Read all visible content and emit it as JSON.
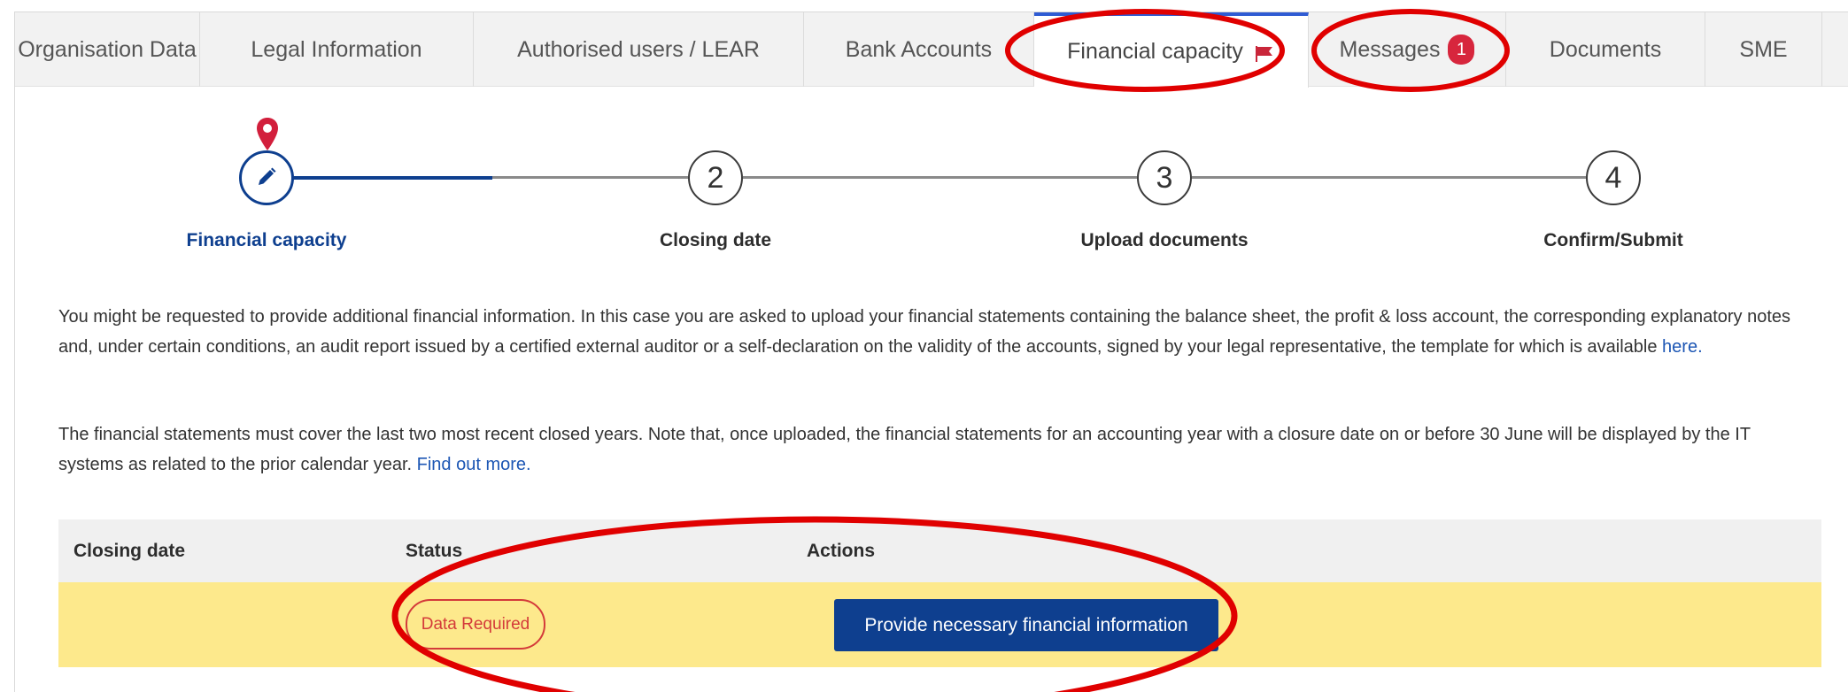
{
  "tabs": [
    {
      "label": "Organisation Data"
    },
    {
      "label": "Legal Information"
    },
    {
      "label": "Authorised users / LEAR"
    },
    {
      "label": "Bank Accounts"
    },
    {
      "label": "Financial capacity",
      "active": true
    },
    {
      "label": "Messages",
      "badge": "1"
    },
    {
      "label": "Documents"
    },
    {
      "label": "SME"
    }
  ],
  "stepper": {
    "steps": [
      {
        "number": "",
        "label": "Financial capacity",
        "state": "current"
      },
      {
        "number": "2",
        "label": "Closing date"
      },
      {
        "number": "3",
        "label": "Upload documents"
      },
      {
        "number": "4",
        "label": "Confirm/Submit"
      }
    ]
  },
  "info": {
    "p1_text": "You might be requested to provide additional financial information. In this case you are asked to upload your financial statements containing the balance sheet, the profit & loss account, the corresponding explanatory notes and, under certain conditions, an audit report issued by a certified external auditor or a self-declaration on the validity of the accounts, signed by your legal representative, the template for which is available ",
    "p1_link": "here.",
    "p2_text": "The financial statements must cover the last two most recent closed years. Note that, once uploaded, the financial statements for an accounting year with a closure date on or before 30 June will be displayed by the IT systems as related to the prior calendar year. ",
    "p2_link": "Find out more."
  },
  "table": {
    "headers": [
      "Closing date",
      "Status",
      "Actions"
    ],
    "rows": [
      {
        "closing_date": "",
        "status": "Data Required",
        "action": "Provide necessary financial information"
      }
    ]
  },
  "colors": {
    "primary": "#0e3f8f",
    "active_tab_border": "#2f5bd3",
    "badge": "#d7263d",
    "row_highlight": "#fde98c",
    "status_required": "#d43a3a",
    "annotation": "#e00000"
  }
}
